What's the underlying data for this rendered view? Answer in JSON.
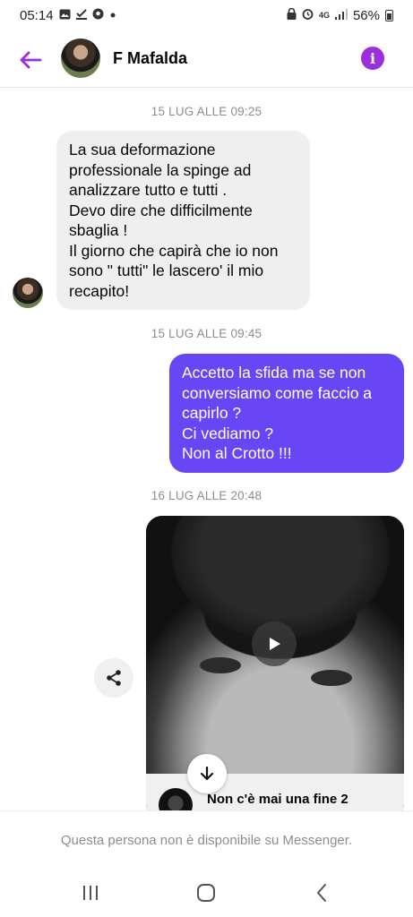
{
  "status_bar": {
    "time": "05:14",
    "network": "4G",
    "battery_percent": "56%",
    "icons": [
      "gallery-icon",
      "download-done-icon",
      "soccer-icon",
      "dot-icon",
      "lock-icon",
      "alarm-icon",
      "signal-icon",
      "battery-icon"
    ]
  },
  "header": {
    "contact_name": "F Mafalda",
    "back_icon": "arrow-left-icon",
    "info_icon": "info-icon"
  },
  "thread": {
    "timestamps": [
      "15 LUG ALLE 09:25",
      "15 LUG ALLE 09:45",
      "16 LUG ALLE 20:48"
    ],
    "incoming_message": {
      "lines": [
        "La sua deformazione",
        "professionale la spinge ad",
        "analizzare tutto e tutti .",
        "Devo dire che difficilmente",
        "sbaglia !",
        "Il giorno che capirà che io non",
        "sono \" tutti\" le lascero' il mio",
        "recapito!"
      ]
    },
    "outgoing_message": {
      "lines": [
        "Accetto la sfida ma se non",
        "conversiamo come faccio a",
        "capirlo ?",
        "Ci vediamo ?",
        "Non al Crotto !!!"
      ]
    },
    "video": {
      "title": "Non c'è mai una fine 2"
    }
  },
  "composer": {
    "unavailable_text": "Questa persona non è disponibile su Messenger."
  },
  "colors": {
    "accent": "#9b2fdc",
    "outgoing_bubble": "#6946f5",
    "incoming_bubble": "#efefef",
    "timestamp": "#8a8d91"
  }
}
